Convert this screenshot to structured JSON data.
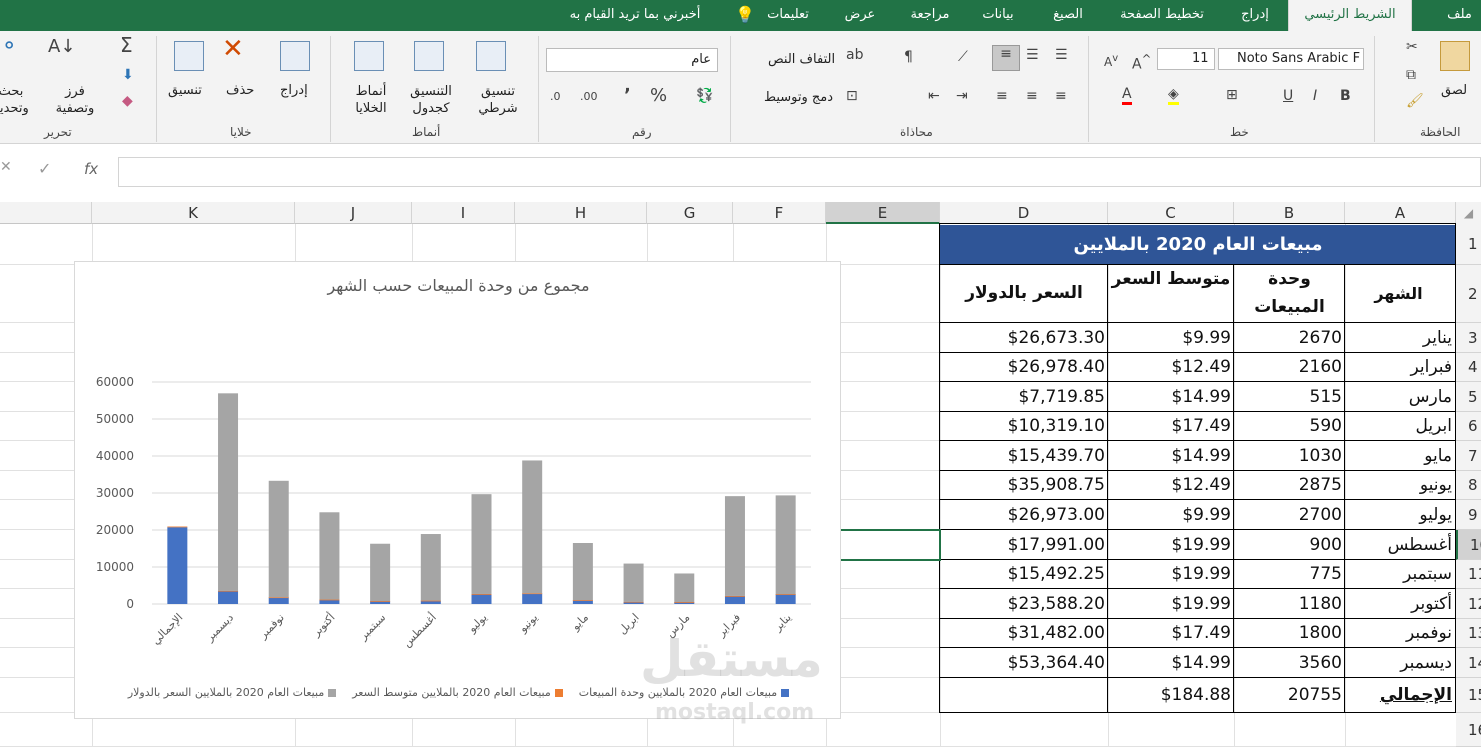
{
  "tabs": [
    "ملف",
    "الشريط الرئيسي",
    "إدراج",
    "تخطيط الصفحة",
    "الصيغ",
    "بيانات",
    "مراجعة",
    "عرض",
    "تعليمات",
    "أخبرني بما تريد القيام به"
  ],
  "ribbon": {
    "clipboard": {
      "paste": "لصق",
      "label": "الحافظة"
    },
    "font": {
      "name": "Noto Sans Arabic F",
      "size": "11",
      "label": "خط",
      "bold": "B",
      "italic": "I",
      "underline": "U"
    },
    "alignment": {
      "wrap": "التفاف النص",
      "merge": "دمج وتوسيط",
      "label": "محاذاة"
    },
    "number": {
      "format": "عام",
      "percent": "%",
      "comma": "٬",
      "label": "رقم"
    },
    "styles": {
      "conditional": "تنسيق شرطي",
      "table": "التنسيق كجدول",
      "cell_styles": "أنماط الخلايا",
      "label": "أنماط"
    },
    "cells": {
      "insert": "إدراج",
      "delete": "حذف",
      "format": "تنسيق",
      "label": "خلايا"
    },
    "editing": {
      "sort": "فرز وتصفية",
      "find": "بحث وتحديد",
      "label": "تحرير"
    }
  },
  "formula_bar": {
    "fx": "fx",
    "cancel": "✕",
    "enter": "✓",
    "value": ""
  },
  "columns": [
    "A",
    "B",
    "C",
    "D",
    "E",
    "F",
    "G",
    "H",
    "I",
    "J",
    "K"
  ],
  "rows": [
    "1",
    "2",
    "3",
    "4",
    "5",
    "6",
    "7",
    "8",
    "9",
    "10",
    "11",
    "12",
    "13",
    "14",
    "15",
    "16"
  ],
  "sheet": {
    "title": "مبيعات العام 2020 بالملايين",
    "headers": {
      "month": "الشهر",
      "units": "وحدة المبيعات",
      "avg": "متوسط السعر",
      "price": "السعر بالدولار"
    },
    "data": [
      {
        "month": "يناير",
        "units": "2670",
        "avg": "$9.99",
        "price": "$26,673.30"
      },
      {
        "month": "فبراير",
        "units": "2160",
        "avg": "$12.49",
        "price": "$26,978.40"
      },
      {
        "month": "مارس",
        "units": "515",
        "avg": "$14.99",
        "price": "$7,719.85"
      },
      {
        "month": "ابريل",
        "units": "590",
        "avg": "$17.49",
        "price": "$10,319.10"
      },
      {
        "month": "مايو",
        "units": "1030",
        "avg": "$14.99",
        "price": "$15,439.70"
      },
      {
        "month": "يونيو",
        "units": "2875",
        "avg": "$12.49",
        "price": "$35,908.75"
      },
      {
        "month": "يوليو",
        "units": "2700",
        "avg": "$9.99",
        "price": "$26,973.00"
      },
      {
        "month": "أغسطس",
        "units": "900",
        "avg": "$19.99",
        "price": "$17,991.00"
      },
      {
        "month": "سبتمبر",
        "units": "775",
        "avg": "$19.99",
        "price": "$15,492.25"
      },
      {
        "month": "أكتوبر",
        "units": "1180",
        "avg": "$19.99",
        "price": "$23,588.20"
      },
      {
        "month": "نوفمبر",
        "units": "1800",
        "avg": "$17.49",
        "price": "$31,482.00"
      },
      {
        "month": "ديسمبر",
        "units": "3560",
        "avg": "$14.99",
        "price": "$53,364.40"
      }
    ],
    "total": {
      "label": "الإجمالي",
      "units": "20755",
      "avg": "$184.88",
      "price": ""
    }
  },
  "watermark": {
    "brand": "مستقل",
    "url": "mostaql.com"
  },
  "chart_data": {
    "type": "bar",
    "stacked": true,
    "title": "مجموع من وحدة المبيعات حسب الشهر",
    "categories": [
      "يناير",
      "فبراير",
      "مارس",
      "ابريل",
      "مايو",
      "يونيو",
      "يوليو",
      "أغسطس",
      "سبتمبر",
      "أكتوبر",
      "نوفمبر",
      "ديسمبر",
      "الإجمالي"
    ],
    "series": [
      {
        "name": "مبيعات العام 2020 بالملايين وحدة المبيعات",
        "color": "#4472c4",
        "values": [
          2670,
          2160,
          515,
          590,
          1030,
          2875,
          2700,
          900,
          775,
          1180,
          1800,
          3560,
          20755
        ]
      },
      {
        "name": "مبيعات العام 2020 بالملايين متوسط السعر",
        "color": "#ed7d31",
        "values": [
          9.99,
          12.49,
          14.99,
          17.49,
          14.99,
          12.49,
          9.99,
          19.99,
          19.99,
          19.99,
          17.49,
          14.99,
          184.88
        ]
      },
      {
        "name": "مبيعات العام 2020 بالملايين السعر بالدولار",
        "color": "#a5a5a5",
        "values": [
          26673.3,
          26978.4,
          7719.85,
          10319.1,
          15439.7,
          35908.75,
          26973,
          17991,
          15492.25,
          23588.2,
          31482,
          53364.4,
          0
        ]
      }
    ],
    "yticks": [
      "0",
      "10000",
      "20000",
      "30000",
      "40000",
      "50000",
      "60000"
    ],
    "ylim": [
      0,
      60000
    ],
    "grid": true,
    "legend": "bottom"
  }
}
